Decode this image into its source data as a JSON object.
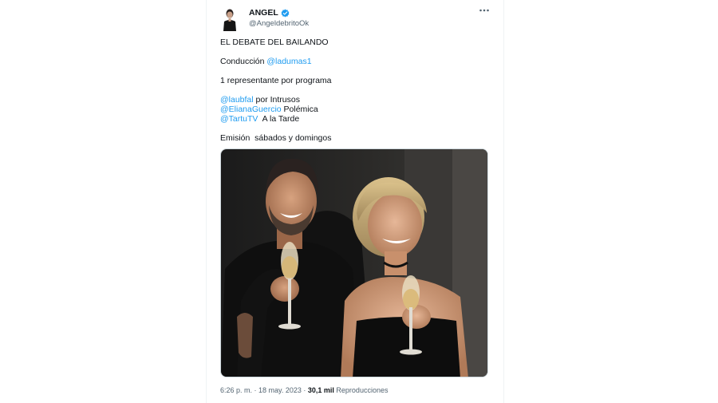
{
  "author": {
    "name": "ANGEL",
    "handle": "@AngeldebritoOk",
    "verified": true
  },
  "tweet": {
    "title": "EL DEBATE DEL BAILANDO",
    "host_label": "Conducción ",
    "host_mention": "@ladumas1",
    "representatives": "1 representante por programa",
    "reps": [
      {
        "mention": "@laubfal",
        "text": " por Intrusos"
      },
      {
        "mention": "@ElianaGuercio",
        "text": " Polémica"
      },
      {
        "mention": "@TartuTV",
        "text": "  A la Tarde"
      }
    ],
    "broadcast": "Emisión  sábados y domingos"
  },
  "footer": {
    "timestamp": "6:26 p. m. · 18 may. 2023 · ",
    "views_count": "30,1 mil",
    "views_label": " Reproducciones"
  },
  "icons": {
    "more": "more-options-icon",
    "verified": "verified-badge-icon"
  },
  "colors": {
    "link": "#1d9bf0",
    "secondary_text": "#536471"
  }
}
